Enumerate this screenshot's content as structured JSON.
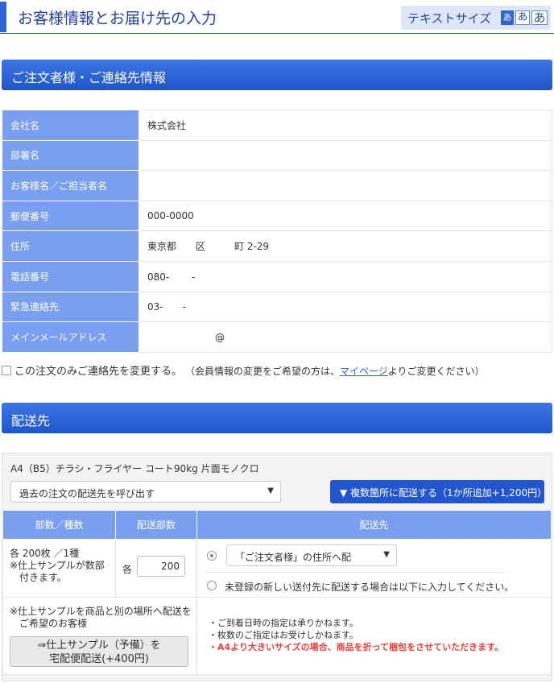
{
  "header": {
    "title": "お客様情報とお届け先の入力",
    "text_size_label": "テキストサイズ",
    "text_size_buttons": [
      "あ",
      "あ",
      "あ"
    ]
  },
  "contact_section": {
    "title": "ご注文者様・ご連絡先情報",
    "rows": [
      {
        "label": "会社名",
        "value": "株式会社"
      },
      {
        "label": "部署名",
        "value": ""
      },
      {
        "label": "お客様名／ご担当者名",
        "value": ""
      },
      {
        "label": "郵便番号",
        "value": "000-0000"
      },
      {
        "label": "住所",
        "value": "東京都　　区　　　町 2-29"
      },
      {
        "label": "電話番号",
        "value": "080-　　 -"
      },
      {
        "label": "緊急連絡先",
        "value": "03-　　-"
      },
      {
        "label": "メインメールアドレス",
        "value": "　　　　　　　@"
      }
    ],
    "change_checkbox_label": "この注文のみご連絡先を変更する。",
    "change_note_prefix": "（会員情報の変更をご希望の方は、",
    "change_note_link": "マイページ",
    "change_note_suffix": "よりご変更ください）"
  },
  "shipping_section": {
    "title": "配送先",
    "product": "A4（B5）チラシ・フライヤー コート90kg 片面モノクロ",
    "past_select": "過去の注文の配送先を呼び出す",
    "multi_button": "▼ 複数箇所に配送する（1か所追加+1,200円）",
    "table_headers": [
      "部数／種数",
      "配送部数",
      "配送先"
    ],
    "qty_line1": "各 200枚 ／1種",
    "qty_line2": "※仕上サンプルが数部",
    "qty_line3": "付きます。",
    "qty_prefix": "各",
    "qty_value": "200",
    "dest_select": "「ご注文者様」の住所へ配",
    "new_dest_label": "未登録の新しい送付先に配送する場合は以下に入力してください。",
    "sample_line1": "※仕上サンプルを商品と別の場所へ配送を",
    "sample_line2": "ご希望のお客様",
    "sample_button_line1": "⇒仕上サンプル（予備）を",
    "sample_button_line2": "宅配便配送(+400円)",
    "notes": [
      "・ご到着日時の指定は承りかねます。",
      "・枚数のご指定はお受けしかねます。"
    ],
    "note_red": "・A4より大きいサイズの場合、商品を折って梱包をさせていただきます。"
  }
}
